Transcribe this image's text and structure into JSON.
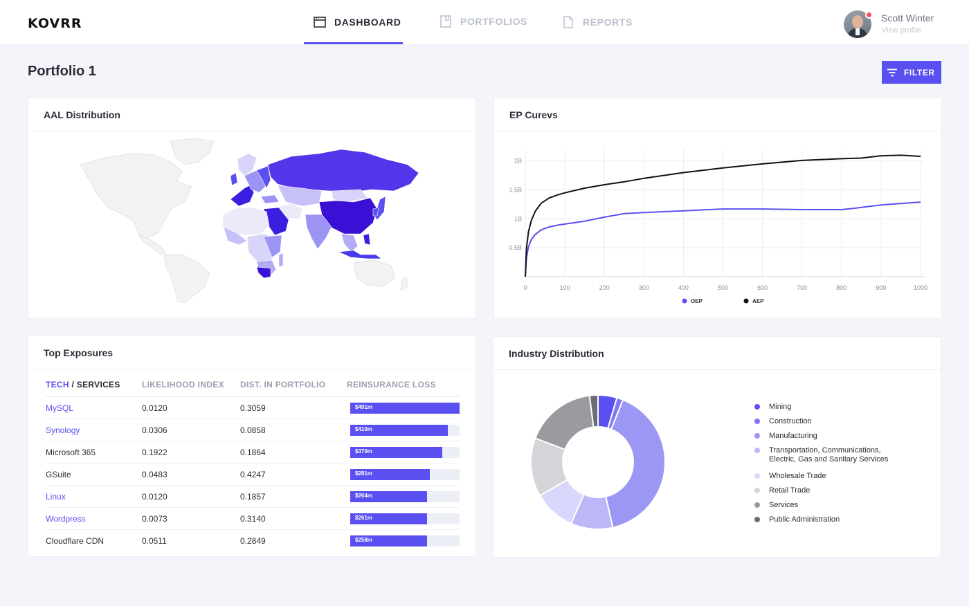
{
  "brand": "KOVRR",
  "nav": {
    "tabs": [
      {
        "label": "DASHBOARD",
        "icon": "window-icon",
        "active": true
      },
      {
        "label": "PORTFOLIOS",
        "icon": "bookmark-book-icon",
        "active": false
      },
      {
        "label": "REPORTS",
        "icon": "document-icon",
        "active": false
      }
    ]
  },
  "user": {
    "name": "Scott Winter",
    "link": "View profile",
    "has_notification": true
  },
  "page": {
    "title": "Portfolio 1",
    "filter_label": "FILTER"
  },
  "cards": {
    "aal": {
      "title": "AAL Distribution"
    },
    "ep": {
      "title": "EP Curevs"
    },
    "exposures": {
      "title": "Top Exposures"
    },
    "industry": {
      "title": "Industry Distribution"
    }
  },
  "exposures": {
    "headers": {
      "tech": "TECH",
      "sep": " / ",
      "services": "SERVICES",
      "likelihood": "LIKELIHOOD INDEX",
      "dist": "DIST. IN PORTFOLIO",
      "loss": "REINSURANCE LOSS"
    },
    "rows": [
      {
        "name": "MySQL",
        "link": true,
        "likelihood": "0.0120",
        "dist": "0.3059",
        "loss_label": "$491m",
        "loss_fraction": 1.0
      },
      {
        "name": "Synology",
        "link": true,
        "likelihood": "0.0306",
        "dist": "0.0858",
        "loss_label": "$410m",
        "loss_fraction": 0.89
      },
      {
        "name": "Microsoft 365",
        "link": false,
        "likelihood": "0.1922",
        "dist": "0.1864",
        "loss_label": "$370m",
        "loss_fraction": 0.84
      },
      {
        "name": "GSuite",
        "link": false,
        "likelihood": "0.0483",
        "dist": "0.4247",
        "loss_label": "$281m",
        "loss_fraction": 0.725
      },
      {
        "name": "Linux",
        "link": true,
        "likelihood": "0.0120",
        "dist": "0.1857",
        "loss_label": "$264m",
        "loss_fraction": 0.703
      },
      {
        "name": "Wordpress",
        "link": true,
        "likelihood": "0.0073",
        "dist": "0.3140",
        "loss_label": "$261m",
        "loss_fraction": 0.703
      },
      {
        "name": "Cloudflare CDN",
        "link": false,
        "likelihood": "0.0511",
        "dist": "0.2849",
        "loss_label": "$258m",
        "loss_fraction": 0.703
      }
    ]
  },
  "colors": {
    "accent": "#5a4ff0",
    "text": "#2b2b36",
    "muted": "#9aa0ae"
  },
  "chart_data": [
    {
      "type": "line",
      "title": "EP Curevs",
      "xlabel": "",
      "ylabel": "",
      "xlim": [
        0,
        1000
      ],
      "ylim": [
        0,
        2200000000
      ],
      "x_ticks": [
        "0",
        "100",
        "200",
        "300",
        "400",
        "500",
        "600",
        "700",
        "800",
        "900",
        "1000"
      ],
      "y_ticks": [
        "0.5B",
        "1B",
        "1.5B",
        "2B"
      ],
      "grid": true,
      "legend": "bottom-center",
      "series": [
        {
          "name": "OEP",
          "color": "#5a4ff0",
          "x": [
            0,
            3,
            8,
            15,
            25,
            40,
            60,
            80,
            100,
            150,
            200,
            250,
            300,
            400,
            500,
            600,
            700,
            800,
            830,
            900,
            1000
          ],
          "y": [
            0,
            330000000,
            520000000,
            640000000,
            730000000,
            810000000,
            860000000,
            890000000,
            910000000,
            960000000,
            1030000000,
            1090000000,
            1110000000,
            1140000000,
            1170000000,
            1170000000,
            1160000000,
            1160000000,
            1180000000,
            1240000000,
            1290000000
          ]
        },
        {
          "name": "AEP",
          "color": "#111111",
          "x": [
            0,
            3,
            8,
            15,
            25,
            40,
            60,
            80,
            100,
            150,
            200,
            250,
            300,
            400,
            500,
            600,
            700,
            800,
            850,
            900,
            950,
            1000
          ],
          "y": [
            0,
            500000000,
            780000000,
            970000000,
            1130000000,
            1270000000,
            1360000000,
            1410000000,
            1450000000,
            1530000000,
            1590000000,
            1640000000,
            1700000000,
            1800000000,
            1880000000,
            1950000000,
            2010000000,
            2040000000,
            2050000000,
            2090000000,
            2100000000,
            2080000000
          ]
        }
      ]
    },
    {
      "type": "pie",
      "title": "Industry Distribution",
      "donut": true,
      "legend": "right",
      "slices": [
        {
          "label": "Mining",
          "value": 4.5,
          "color": "#5a4ff0"
        },
        {
          "label": "Construction",
          "value": 1.5,
          "color": "#7f78f2"
        },
        {
          "label": "Manufacturing",
          "value": 40,
          "color": "#9c96f5"
        },
        {
          "label": "Transportation, Communications, Electric, Gas and Sanitary Services",
          "value": 10,
          "color": "#bcb8f8"
        },
        {
          "label": "Wholesale Trade",
          "value": 10,
          "color": "#d9d7fb"
        },
        {
          "label": "Retail Trade",
          "value": 14,
          "color": "#d4d4d9"
        },
        {
          "label": "Services",
          "value": 17,
          "color": "#9a9aa0"
        },
        {
          "label": "Public Administration",
          "value": 2,
          "color": "#6c6c72"
        }
      ]
    }
  ]
}
